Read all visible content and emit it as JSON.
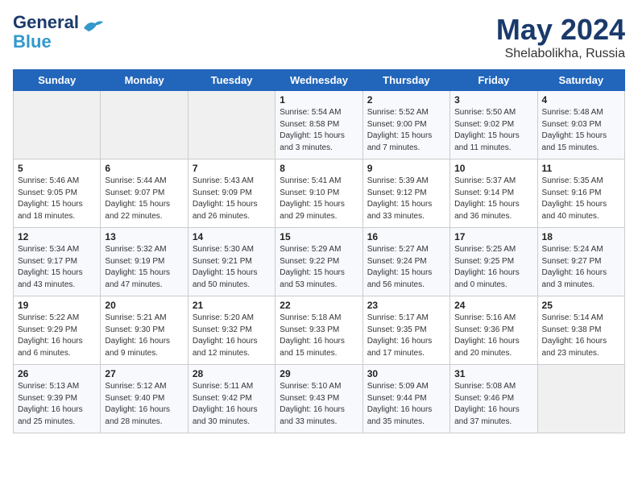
{
  "header": {
    "logo_line1": "General",
    "logo_line2": "Blue",
    "month_year": "May 2024",
    "location": "Shelabolikha, Russia"
  },
  "weekdays": [
    "Sunday",
    "Monday",
    "Tuesday",
    "Wednesday",
    "Thursday",
    "Friday",
    "Saturday"
  ],
  "weeks": [
    [
      {
        "day": "",
        "info": ""
      },
      {
        "day": "",
        "info": ""
      },
      {
        "day": "",
        "info": ""
      },
      {
        "day": "1",
        "info": "Sunrise: 5:54 AM\nSunset: 8:58 PM\nDaylight: 15 hours\nand 3 minutes."
      },
      {
        "day": "2",
        "info": "Sunrise: 5:52 AM\nSunset: 9:00 PM\nDaylight: 15 hours\nand 7 minutes."
      },
      {
        "day": "3",
        "info": "Sunrise: 5:50 AM\nSunset: 9:02 PM\nDaylight: 15 hours\nand 11 minutes."
      },
      {
        "day": "4",
        "info": "Sunrise: 5:48 AM\nSunset: 9:03 PM\nDaylight: 15 hours\nand 15 minutes."
      }
    ],
    [
      {
        "day": "5",
        "info": "Sunrise: 5:46 AM\nSunset: 9:05 PM\nDaylight: 15 hours\nand 18 minutes."
      },
      {
        "day": "6",
        "info": "Sunrise: 5:44 AM\nSunset: 9:07 PM\nDaylight: 15 hours\nand 22 minutes."
      },
      {
        "day": "7",
        "info": "Sunrise: 5:43 AM\nSunset: 9:09 PM\nDaylight: 15 hours\nand 26 minutes."
      },
      {
        "day": "8",
        "info": "Sunrise: 5:41 AM\nSunset: 9:10 PM\nDaylight: 15 hours\nand 29 minutes."
      },
      {
        "day": "9",
        "info": "Sunrise: 5:39 AM\nSunset: 9:12 PM\nDaylight: 15 hours\nand 33 minutes."
      },
      {
        "day": "10",
        "info": "Sunrise: 5:37 AM\nSunset: 9:14 PM\nDaylight: 15 hours\nand 36 minutes."
      },
      {
        "day": "11",
        "info": "Sunrise: 5:35 AM\nSunset: 9:16 PM\nDaylight: 15 hours\nand 40 minutes."
      }
    ],
    [
      {
        "day": "12",
        "info": "Sunrise: 5:34 AM\nSunset: 9:17 PM\nDaylight: 15 hours\nand 43 minutes."
      },
      {
        "day": "13",
        "info": "Sunrise: 5:32 AM\nSunset: 9:19 PM\nDaylight: 15 hours\nand 47 minutes."
      },
      {
        "day": "14",
        "info": "Sunrise: 5:30 AM\nSunset: 9:21 PM\nDaylight: 15 hours\nand 50 minutes."
      },
      {
        "day": "15",
        "info": "Sunrise: 5:29 AM\nSunset: 9:22 PM\nDaylight: 15 hours\nand 53 minutes."
      },
      {
        "day": "16",
        "info": "Sunrise: 5:27 AM\nSunset: 9:24 PM\nDaylight: 15 hours\nand 56 minutes."
      },
      {
        "day": "17",
        "info": "Sunrise: 5:25 AM\nSunset: 9:25 PM\nDaylight: 16 hours\nand 0 minutes."
      },
      {
        "day": "18",
        "info": "Sunrise: 5:24 AM\nSunset: 9:27 PM\nDaylight: 16 hours\nand 3 minutes."
      }
    ],
    [
      {
        "day": "19",
        "info": "Sunrise: 5:22 AM\nSunset: 9:29 PM\nDaylight: 16 hours\nand 6 minutes."
      },
      {
        "day": "20",
        "info": "Sunrise: 5:21 AM\nSunset: 9:30 PM\nDaylight: 16 hours\nand 9 minutes."
      },
      {
        "day": "21",
        "info": "Sunrise: 5:20 AM\nSunset: 9:32 PM\nDaylight: 16 hours\nand 12 minutes."
      },
      {
        "day": "22",
        "info": "Sunrise: 5:18 AM\nSunset: 9:33 PM\nDaylight: 16 hours\nand 15 minutes."
      },
      {
        "day": "23",
        "info": "Sunrise: 5:17 AM\nSunset: 9:35 PM\nDaylight: 16 hours\nand 17 minutes."
      },
      {
        "day": "24",
        "info": "Sunrise: 5:16 AM\nSunset: 9:36 PM\nDaylight: 16 hours\nand 20 minutes."
      },
      {
        "day": "25",
        "info": "Sunrise: 5:14 AM\nSunset: 9:38 PM\nDaylight: 16 hours\nand 23 minutes."
      }
    ],
    [
      {
        "day": "26",
        "info": "Sunrise: 5:13 AM\nSunset: 9:39 PM\nDaylight: 16 hours\nand 25 minutes."
      },
      {
        "day": "27",
        "info": "Sunrise: 5:12 AM\nSunset: 9:40 PM\nDaylight: 16 hours\nand 28 minutes."
      },
      {
        "day": "28",
        "info": "Sunrise: 5:11 AM\nSunset: 9:42 PM\nDaylight: 16 hours\nand 30 minutes."
      },
      {
        "day": "29",
        "info": "Sunrise: 5:10 AM\nSunset: 9:43 PM\nDaylight: 16 hours\nand 33 minutes."
      },
      {
        "day": "30",
        "info": "Sunrise: 5:09 AM\nSunset: 9:44 PM\nDaylight: 16 hours\nand 35 minutes."
      },
      {
        "day": "31",
        "info": "Sunrise: 5:08 AM\nSunset: 9:46 PM\nDaylight: 16 hours\nand 37 minutes."
      },
      {
        "day": "",
        "info": ""
      }
    ]
  ]
}
